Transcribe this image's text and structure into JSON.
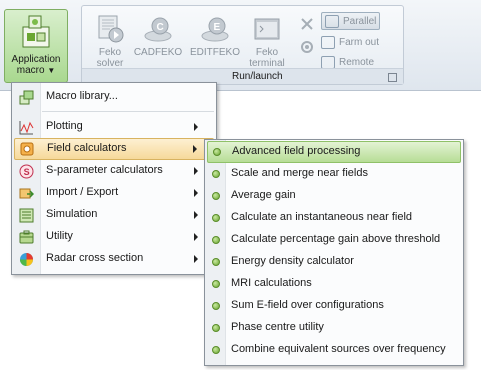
{
  "ribbon": {
    "app_macro": {
      "line1": "Application",
      "line2": "macro",
      "icon": "puzzle-icon"
    },
    "buttons": [
      {
        "line1": "Feko",
        "line2": "solver",
        "icon": "solver-icon"
      },
      {
        "line1": "CADFEKO",
        "line2": "",
        "icon": "cadfeko-icon"
      },
      {
        "line1": "EDITFEKO",
        "line2": "",
        "icon": "editfeko-icon"
      },
      {
        "line1": "Feko",
        "line2": "terminal",
        "icon": "terminal-icon"
      }
    ],
    "small_buttons": [
      {
        "label": "Parallel",
        "icon": "parallel-icon"
      },
      {
        "label": "Farm out",
        "icon": "farm-out-icon"
      },
      {
        "label": "Remote",
        "icon": "remote-icon"
      }
    ],
    "group_label": "Run/launch"
  },
  "menu": {
    "macro_library": "Macro library...",
    "items": [
      {
        "label": "Plotting",
        "icon": "plot-icon"
      },
      {
        "label": "Field calculators",
        "icon": "field-calculator-icon"
      },
      {
        "label": "S-parameter calculators",
        "icon": "s-parameter-icon"
      },
      {
        "label": "Import / Export",
        "icon": "import-export-icon"
      },
      {
        "label": "Simulation",
        "icon": "simulation-icon"
      },
      {
        "label": "Utility",
        "icon": "utility-icon"
      },
      {
        "label": "Radar cross section",
        "icon": "radar-icon"
      }
    ]
  },
  "submenu": {
    "items": [
      "Advanced field processing",
      "Scale and merge near fields",
      "Average gain",
      "Calculate an instantaneous near field",
      "Calculate percentage gain above threshold",
      "Energy density calculator",
      "MRI calculations",
      "Sum E-field over configurations",
      "Phase centre utility",
      "Combine equivalent sources over frequency"
    ]
  },
  "colors": {
    "app_macro_bg": "#a9d88f",
    "menu_highlight": "#f6d99a",
    "submenu_highlight": "#b7dd96",
    "bullet": "#6aa632"
  }
}
